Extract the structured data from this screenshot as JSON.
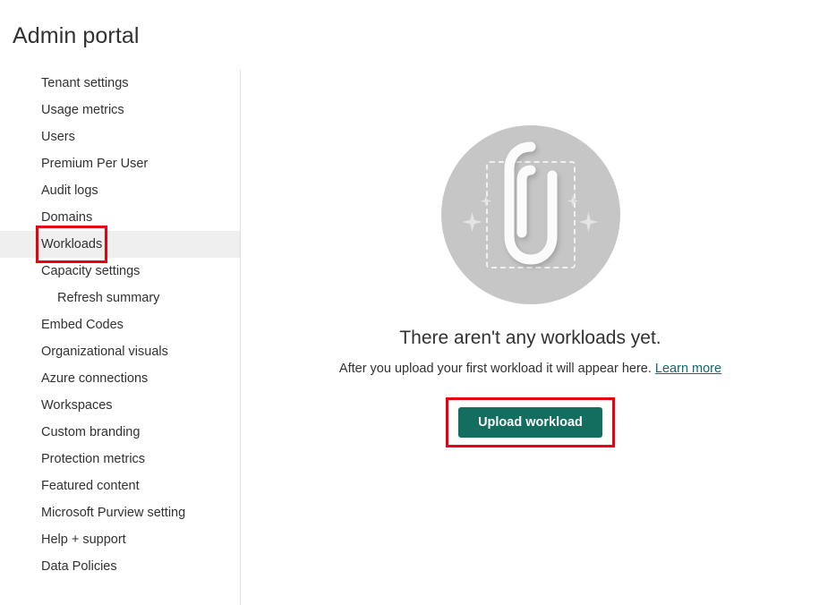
{
  "header": {
    "title": "Admin portal"
  },
  "sidebar": {
    "items": [
      {
        "label": "Tenant settings",
        "indented": false,
        "selected": false,
        "annotated": false
      },
      {
        "label": "Usage metrics",
        "indented": false,
        "selected": false,
        "annotated": false
      },
      {
        "label": "Users",
        "indented": false,
        "selected": false,
        "annotated": false
      },
      {
        "label": "Premium Per User",
        "indented": false,
        "selected": false,
        "annotated": false
      },
      {
        "label": "Audit logs",
        "indented": false,
        "selected": false,
        "annotated": false
      },
      {
        "label": "Domains",
        "indented": false,
        "selected": false,
        "annotated": false
      },
      {
        "label": "Workloads",
        "indented": false,
        "selected": true,
        "annotated": true
      },
      {
        "label": "Capacity settings",
        "indented": false,
        "selected": false,
        "annotated": false
      },
      {
        "label": "Refresh summary",
        "indented": true,
        "selected": false,
        "annotated": false
      },
      {
        "label": "Embed Codes",
        "indented": false,
        "selected": false,
        "annotated": false
      },
      {
        "label": "Organizational visuals",
        "indented": false,
        "selected": false,
        "annotated": false
      },
      {
        "label": "Azure connections",
        "indented": false,
        "selected": false,
        "annotated": false
      },
      {
        "label": "Workspaces",
        "indented": false,
        "selected": false,
        "annotated": false
      },
      {
        "label": "Custom branding",
        "indented": false,
        "selected": false,
        "annotated": false
      },
      {
        "label": "Protection metrics",
        "indented": false,
        "selected": false,
        "annotated": false
      },
      {
        "label": "Featured content",
        "indented": false,
        "selected": false,
        "annotated": false
      },
      {
        "label": "Microsoft Purview setting",
        "indented": false,
        "selected": false,
        "annotated": false
      },
      {
        "label": "Help + support",
        "indented": false,
        "selected": false,
        "annotated": false
      },
      {
        "label": "Data Policies",
        "indented": false,
        "selected": false,
        "annotated": false
      }
    ]
  },
  "main": {
    "empty_state": {
      "illustration_icon": "paperclip-attachment-icon",
      "headline": "There aren't any workloads yet.",
      "description": "After you upload your first workload it will appear here.",
      "learn_more_label": "Learn more",
      "upload_button_label": "Upload workload"
    }
  },
  "colors": {
    "accent_button": "#136e5f",
    "link": "#0f6b6e",
    "annotation_highlight": "#e60012",
    "selected_row": "#efefef",
    "illustration_circle": "#c6c6c6",
    "text": "#323130"
  }
}
